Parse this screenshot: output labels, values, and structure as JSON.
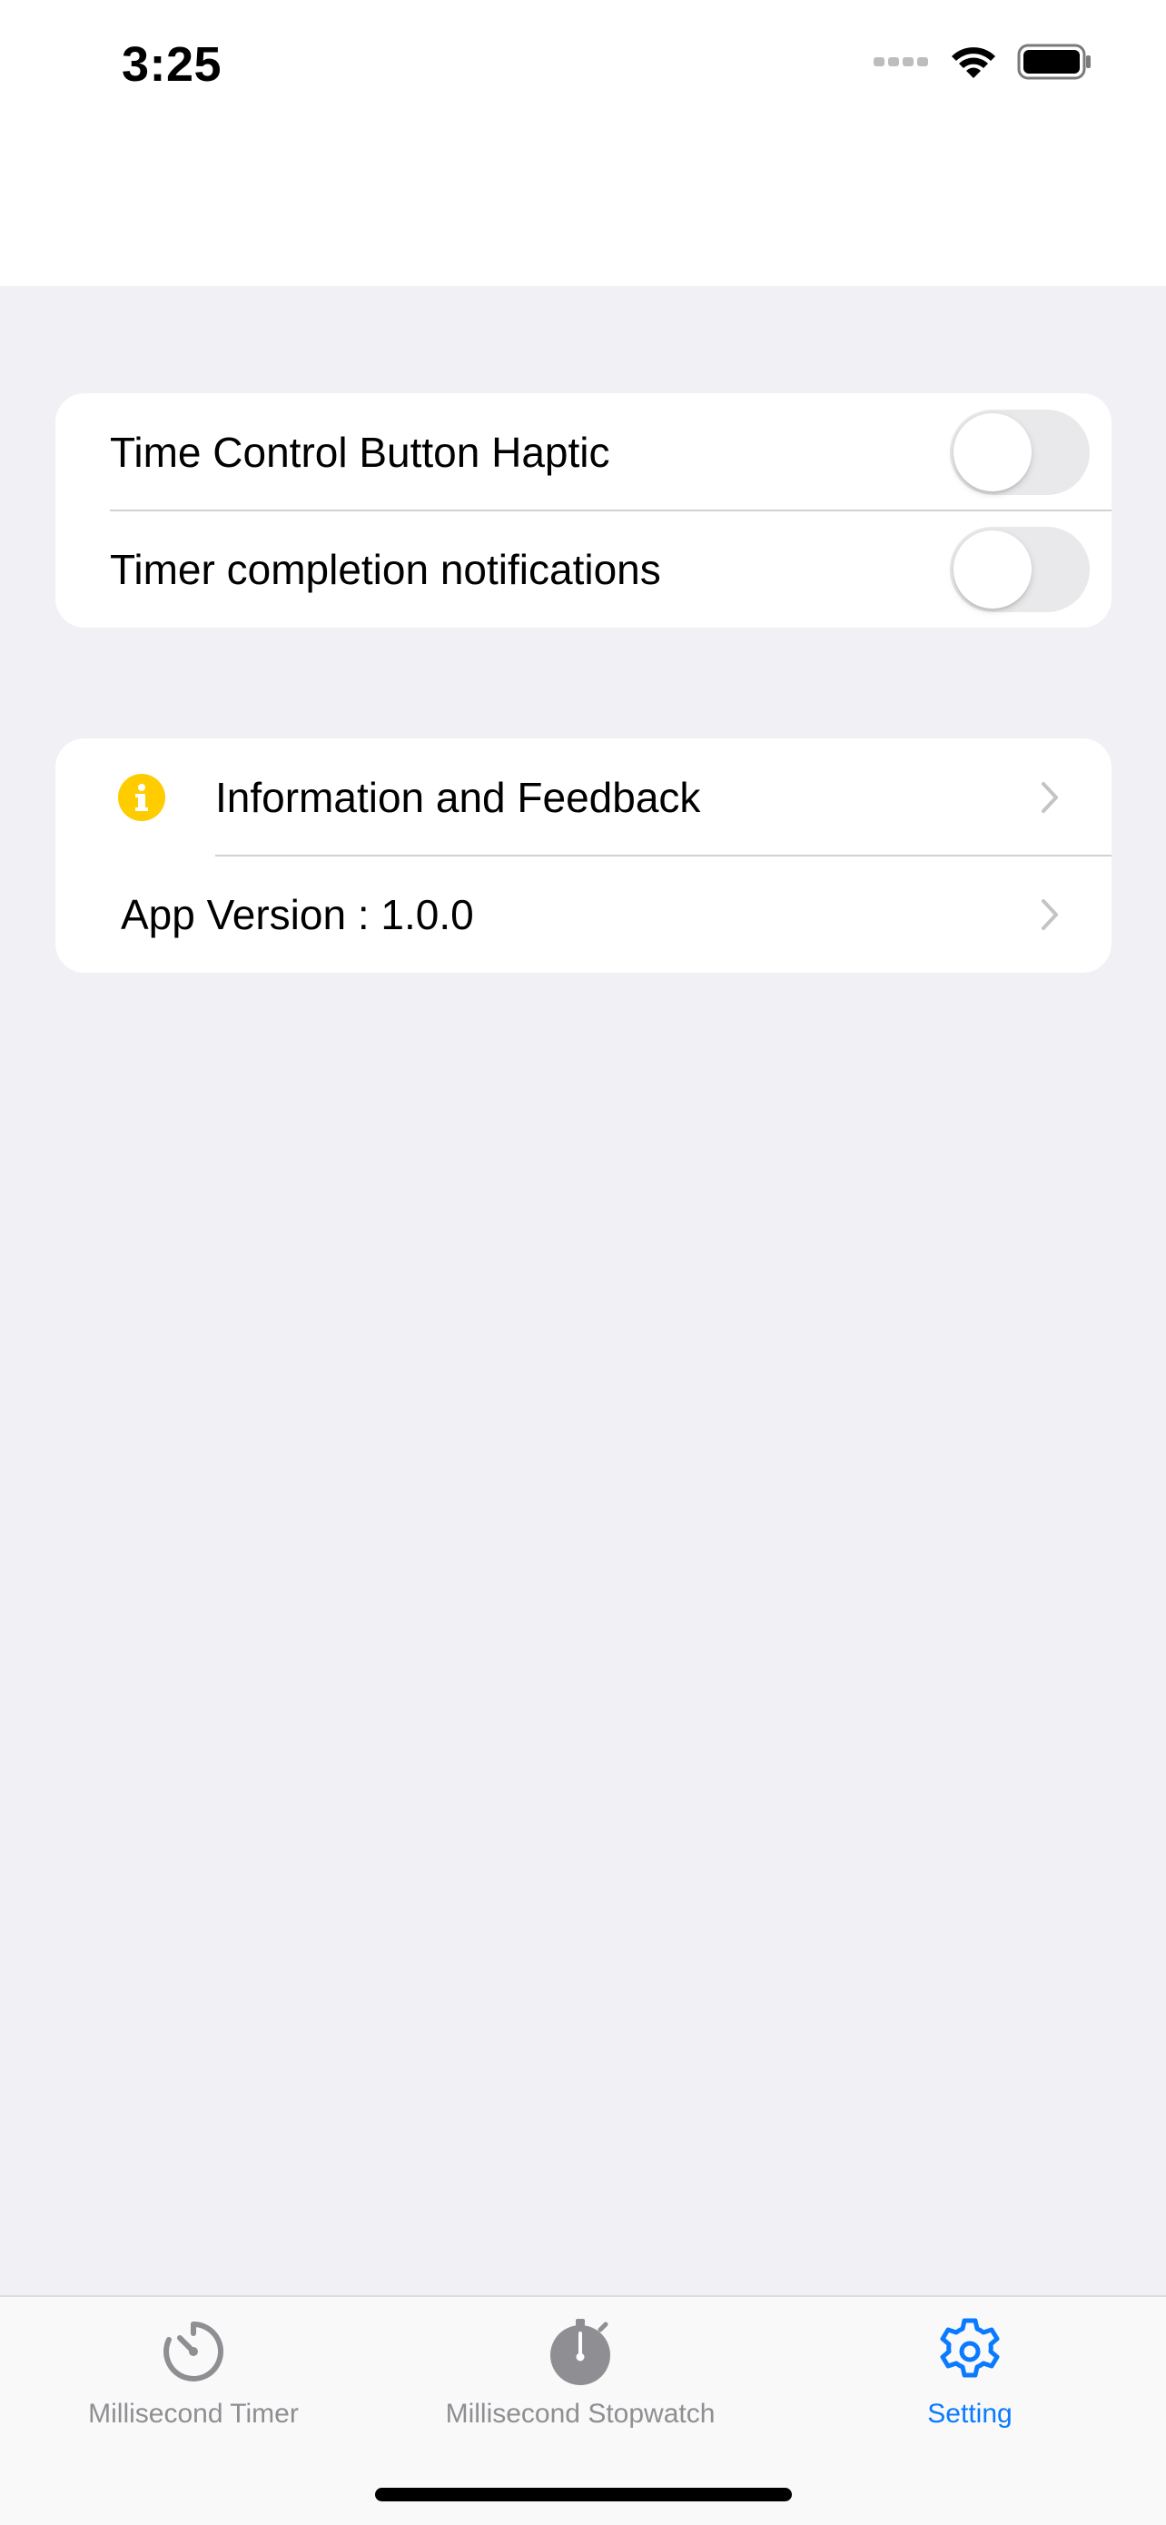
{
  "status_bar": {
    "time": "3:25",
    "icons": [
      "signal-icon",
      "wifi-icon",
      "battery-icon"
    ]
  },
  "settings_group": {
    "rows": [
      {
        "label": "Time Control Button Haptic",
        "toggle_on": false
      },
      {
        "label": "Timer completion notifications",
        "toggle_on": false
      }
    ]
  },
  "info_group": {
    "rows": [
      {
        "label": "Information and Feedback",
        "icon": "info-icon"
      },
      {
        "label": "App Version : 1.0.0"
      }
    ]
  },
  "tab_bar": {
    "tabs": [
      {
        "label": "Millisecond Timer",
        "icon": "timer-icon",
        "active": false
      },
      {
        "label": "Millisecond Stopwatch",
        "icon": "stopwatch-icon",
        "active": false
      },
      {
        "label": "Setting",
        "icon": "gear-icon",
        "active": true
      }
    ]
  },
  "colors": {
    "accent": "#0a7aff",
    "background": "#f0f0f5",
    "info_icon": "#ffcc00",
    "inactive_tab": "#8e8e93"
  }
}
